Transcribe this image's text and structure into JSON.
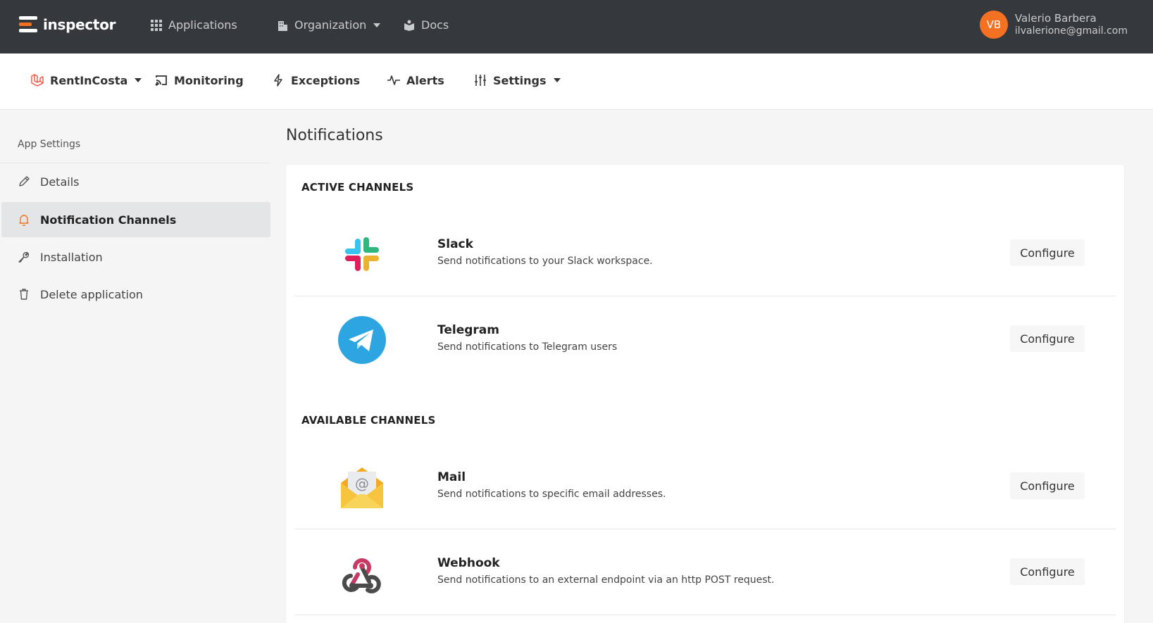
{
  "brand": {
    "name": "inspector"
  },
  "topnav": {
    "applications": "Applications",
    "organization": "Organization",
    "docs": "Docs"
  },
  "user": {
    "initials": "VB",
    "name": "Valerio Barbera",
    "email": "ilvalerione@gmail.com"
  },
  "subnav": {
    "app": "RentInCosta",
    "monitoring": "Monitoring",
    "exceptions": "Exceptions",
    "alerts": "Alerts",
    "settings": "Settings"
  },
  "sidebar": {
    "heading": "App Settings",
    "items": [
      {
        "label": "Details"
      },
      {
        "label": "Notification Channels"
      },
      {
        "label": "Installation"
      },
      {
        "label": "Delete application"
      }
    ]
  },
  "main": {
    "title": "Notifications",
    "active_title": "ACTIVE CHANNELS",
    "available_title": "AVAILABLE CHANNELS",
    "configure_label": "Configure",
    "channels": [
      {
        "name": "Slack",
        "description": "Send notifications to your Slack workspace."
      },
      {
        "name": "Telegram",
        "description": "Send notifications to Telegram users"
      },
      {
        "name": "Mail",
        "description": "Send notifications to specific email addresses."
      },
      {
        "name": "Webhook",
        "description": "Send notifications to an external endpoint via an http POST request."
      }
    ]
  },
  "colors": {
    "accent": "#f47121",
    "topbar": "#35383d"
  }
}
